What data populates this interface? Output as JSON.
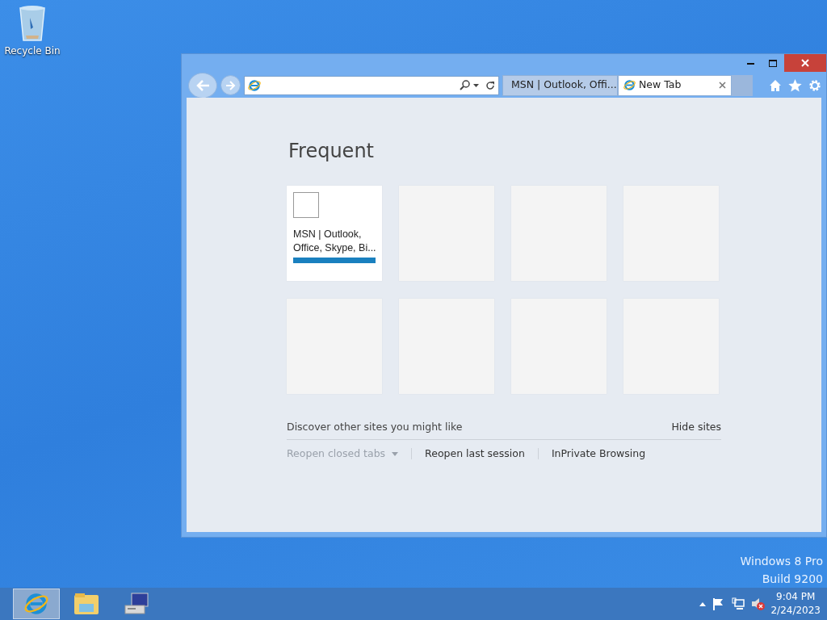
{
  "desktop": {
    "icons": [
      {
        "label": "Recycle Bin"
      }
    ],
    "edition_lines": [
      "Windows 8 Pro",
      "Build 9200"
    ]
  },
  "browser": {
    "tabs": [
      {
        "label": "MSN | Outlook, Offi...",
        "selected": false
      },
      {
        "label": "New Tab",
        "selected": true
      }
    ],
    "new_tab": {
      "heading": "Frequent",
      "tiles": [
        {
          "kind": "site",
          "title": "MSN | Outlook, Office, Skype, Bi...",
          "level": 1
        },
        {
          "kind": "empty"
        },
        {
          "kind": "empty"
        },
        {
          "kind": "empty"
        },
        {
          "kind": "empty"
        },
        {
          "kind": "empty"
        },
        {
          "kind": "empty"
        },
        {
          "kind": "empty"
        }
      ],
      "discover": "Discover other sites you might like",
      "hide": "Hide sites",
      "links": [
        {
          "label": "Reopen closed tabs",
          "disabled": true,
          "kind": "menu"
        },
        {
          "label": "Reopen last session",
          "disabled": false,
          "kind": "link"
        },
        {
          "label": "InPrivate Browsing",
          "disabled": false,
          "kind": "link"
        }
      ]
    }
  },
  "taskbar": {
    "apps": [
      {
        "kind": "browser",
        "selected": true
      },
      {
        "kind": "folder",
        "selected": false
      },
      {
        "kind": "computer",
        "selected": false
      }
    ],
    "clock": {
      "time": "9:04 PM",
      "date": "2/24/2023"
    }
  }
}
